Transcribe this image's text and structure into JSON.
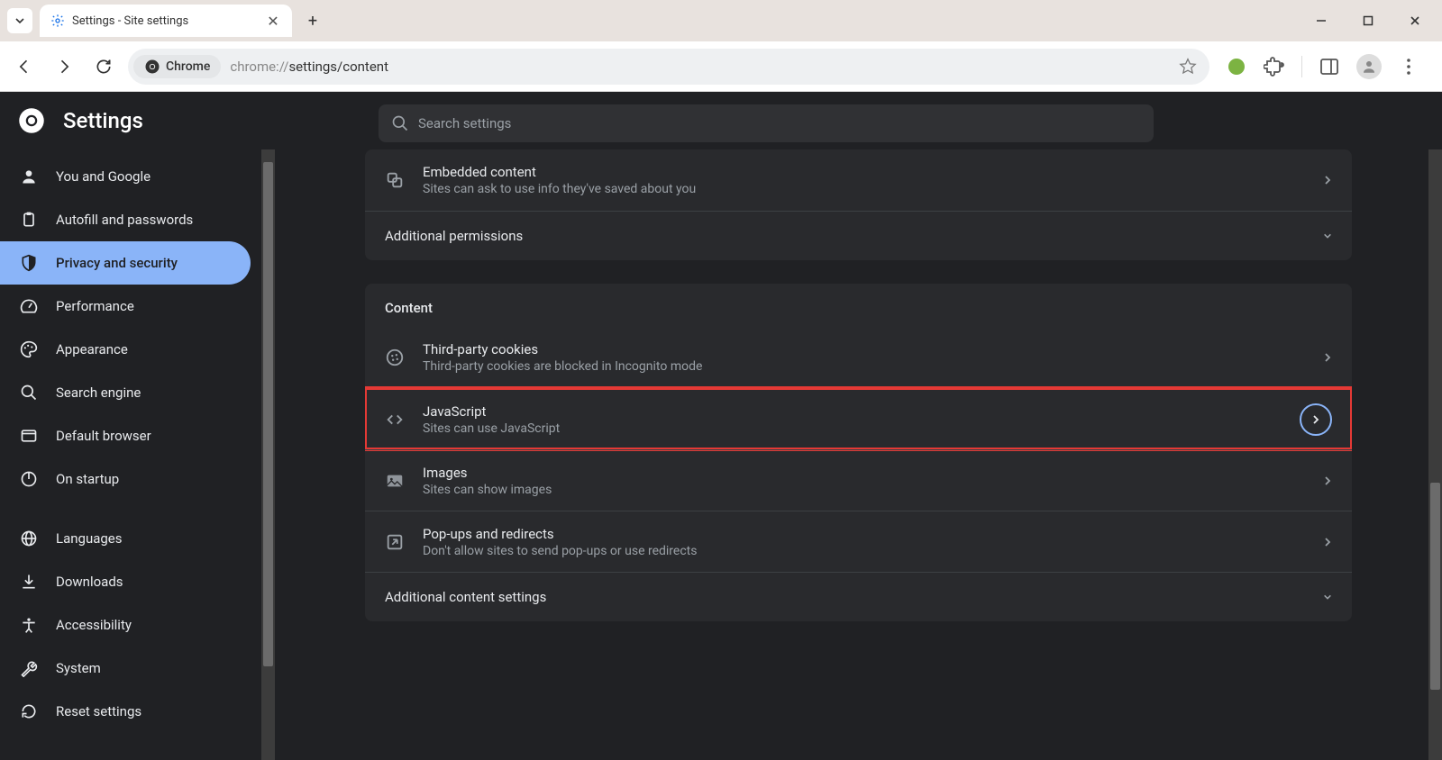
{
  "browser": {
    "tab_title": "Settings - Site settings",
    "chrome_chip": "Chrome",
    "url_scheme": "chrome://",
    "url_path": "settings/content"
  },
  "header": {
    "title": "Settings",
    "search_placeholder": "Search settings"
  },
  "sidebar": {
    "items": [
      {
        "label": "You and Google",
        "icon": "person"
      },
      {
        "label": "Autofill and passwords",
        "icon": "clipboard"
      },
      {
        "label": "Privacy and security",
        "icon": "shield",
        "active": true
      },
      {
        "label": "Performance",
        "icon": "speed"
      },
      {
        "label": "Appearance",
        "icon": "palette"
      },
      {
        "label": "Search engine",
        "icon": "search"
      },
      {
        "label": "Default browser",
        "icon": "browser"
      },
      {
        "label": "On startup",
        "icon": "power"
      },
      {
        "label": "Languages",
        "icon": "globe"
      },
      {
        "label": "Downloads",
        "icon": "download"
      },
      {
        "label": "Accessibility",
        "icon": "accessibility"
      },
      {
        "label": "System",
        "icon": "wrench"
      },
      {
        "label": "Reset settings",
        "icon": "reset"
      }
    ]
  },
  "content": {
    "top_rows": [
      {
        "title": "Embedded content",
        "sub": "Sites can ask to use info they've saved about you",
        "icon": "embed"
      }
    ],
    "additional_permissions": "Additional permissions",
    "section_title": "Content",
    "rows": [
      {
        "title": "Third-party cookies",
        "sub": "Third-party cookies are blocked in Incognito mode",
        "icon": "cookie"
      },
      {
        "title": "JavaScript",
        "sub": "Sites can use JavaScript",
        "icon": "code",
        "highlighted": true
      },
      {
        "title": "Images",
        "sub": "Sites can show images",
        "icon": "image"
      },
      {
        "title": "Pop-ups and redirects",
        "sub": "Don't allow sites to send pop-ups or use redirects",
        "icon": "popup"
      }
    ],
    "additional_content": "Additional content settings"
  }
}
